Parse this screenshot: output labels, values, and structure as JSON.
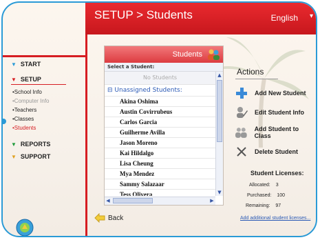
{
  "header": {
    "title": "SETUP > Students",
    "language": "English"
  },
  "sidebar": {
    "start": "START",
    "setup": "SETUP",
    "setup_items": [
      "•School Info",
      "•Computer Info",
      "•Teachers",
      "•Classes",
      "•Students"
    ],
    "reports": "REPORTS",
    "support": "SUPPORT"
  },
  "students_panel": {
    "title": "Students",
    "select_label": "Select a Student:",
    "no_students": "No Students",
    "group_label": "⊟ Unassigned Students:",
    "students": [
      "Akina Oshima",
      "Austin Covirrubeus",
      "Carlos Garcia",
      "Guilherme Avilla",
      "Jason Moreno",
      "Kai Hildalgo",
      "Lisa Cheung",
      "Mya Mendez",
      "Sammy Salazaar",
      "Tess Olivera"
    ]
  },
  "actions": {
    "title": "Actions",
    "add": "Add New Student",
    "edit": "Edit Student Info",
    "add_to_class": "Add Student to Class",
    "delete": "Delete Student"
  },
  "licenses": {
    "title": "Student Licenses:",
    "allocated_label": "Allocated:",
    "allocated": "3",
    "purchased_label": "Purchased:",
    "purchased": "100",
    "remaining_label": "Remaining:",
    "remaining": "97",
    "link": "Add additional student licenses..."
  },
  "back": "Back",
  "colors": {
    "accent_red": "#d61d22",
    "frame_blue": "#2a9ad6",
    "group_blue": "#2a59b5"
  }
}
